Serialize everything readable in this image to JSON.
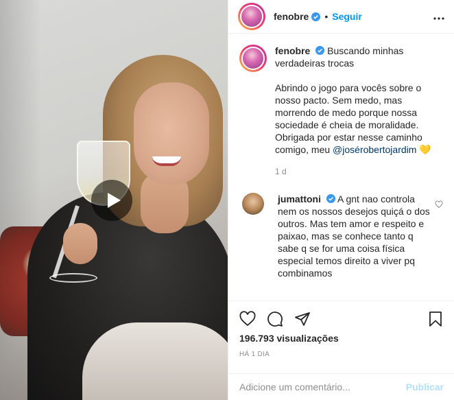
{
  "post": {
    "author": "fenobre",
    "follow_label": "Seguir",
    "separator": "•",
    "caption_username": "fenobre",
    "caption_line1": "Buscando minhas verdadeiras trocas",
    "caption_body": "Abrindo o jogo para vocês sobre o nosso pacto. Sem medo, mas morrendo de medo porque nossa sociedade é cheia de moralidade. Obrigada por estar nesse caminho comigo, meu ",
    "caption_mention": "@josérobertojardim",
    "caption_emoji": "💛",
    "caption_time": "1 d"
  },
  "comment": {
    "username": "jumattoni",
    "text": "A gnt nao controla nem os nossos desejos quiçá o dos outros. Mas tem amor e respeito e paixao, mas se conhece tanto q sabe q se for uma coisa física especial temos direito a viver pq combinamos"
  },
  "stats": {
    "views": "196.793 visualizações",
    "ago": "HÁ 1 DIA"
  },
  "composer": {
    "placeholder": "Adicione um comentário...",
    "publish_label": "Publicar"
  },
  "colors": {
    "accent": "#0095f6",
    "publish_disabled": "#b2dffc",
    "muted": "#8e8e8e",
    "text": "#262626"
  },
  "icons": [
    "play-icon",
    "verified-badge-icon",
    "more-options-icon",
    "heart-icon",
    "comment-icon",
    "share-icon",
    "bookmark-icon"
  ]
}
